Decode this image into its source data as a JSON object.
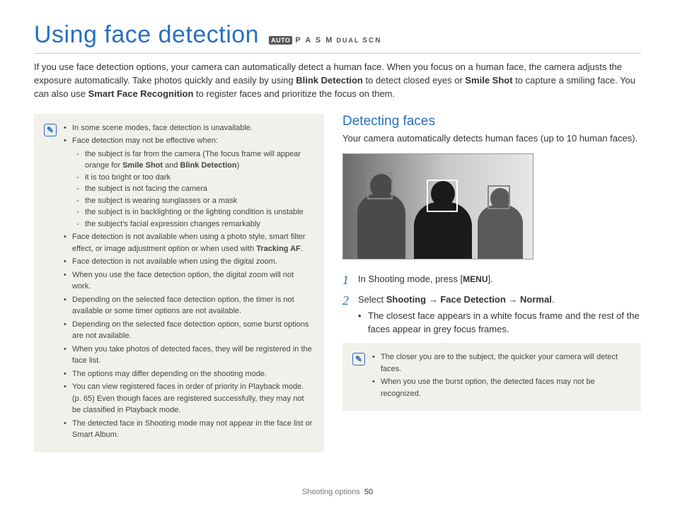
{
  "header": {
    "title": "Using face detection",
    "modes": {
      "auto": "AUTO",
      "pasm": "P A S M",
      "dual": "DUAL",
      "scn": "SCN"
    }
  },
  "intro": {
    "t1": "If you use face detection options, your camera can automatically detect a human face. When you focus on a human face, the camera adjusts the exposure automatically. Take photos quickly and easily by using ",
    "b1": "Blink Detection",
    "t2": " to detect closed eyes or ",
    "b2": "Smile Shot",
    "t3": " to capture a smiling face. You can also use ",
    "b3": "Smart Face Recognition",
    "t4": " to register faces and prioritize the focus on them."
  },
  "note1": {
    "i0": "In some scene modes, face detection is unavailable.",
    "i1": "Face detection may not be effective when:",
    "s0a": "the subject is far from the camera (The focus frame will appear orange for ",
    "s0b1": "Smile Shot",
    "s0c": " and ",
    "s0b2": "Blink Detection",
    "s0d": ")",
    "s1": "it is too bright or too dark",
    "s2": "the subject is not facing the camera",
    "s3": "the subject is wearing sunglasses or a mask",
    "s4": "the subject is in backlighting or the lighting condition is unstable",
    "s5": "the subject's facial expression changes remarkably",
    "i2a": "Face detection is not available when using a photo style, smart filter effect, or image adjustment option or when used with ",
    "i2b": "Tracking AF",
    "i2c": ".",
    "i3": "Face detection is not available when using the digital zoom.",
    "i4": "When you use the face detection option, the digital zoom will not work.",
    "i5": "Depending on the selected face detection option, the timer is not available or some timer options are not available.",
    "i6": "Depending on the selected face detection option, some burst options are not available.",
    "i7": "When you take photos of detected faces, they will be registered in the face list.",
    "i8": "The options may differ depending on the shooting mode.",
    "i9": "You can view registered faces in order of priority in Playback mode. (p. 65) Even though faces are registered successfully, they may not be classified in Playback mode.",
    "i10": "The detected face in Shooting mode may not appear in the face list or Smart Album."
  },
  "right": {
    "title": "Detecting faces",
    "text": "Your camera automatically detects human faces (up to 10 human faces).",
    "step1a": "In Shooting mode, press [",
    "step1b": "MENU",
    "step1c": "].",
    "step2a": "Select ",
    "step2b": "Shooting",
    "step2arr1": " → ",
    "step2c": "Face Detection",
    "step2arr2": " → ",
    "step2d": "Normal",
    "step2e": ".",
    "sub1": "The closest face appears in a white focus frame and the rest of the faces appear in grey focus frames."
  },
  "note2": {
    "i0": "The closer you are to the subject, the quicker your camera will detect faces.",
    "i1": "When you use the burst option, the detected faces may not be recognized."
  },
  "footer": {
    "section": "Shooting options",
    "page": "50"
  }
}
